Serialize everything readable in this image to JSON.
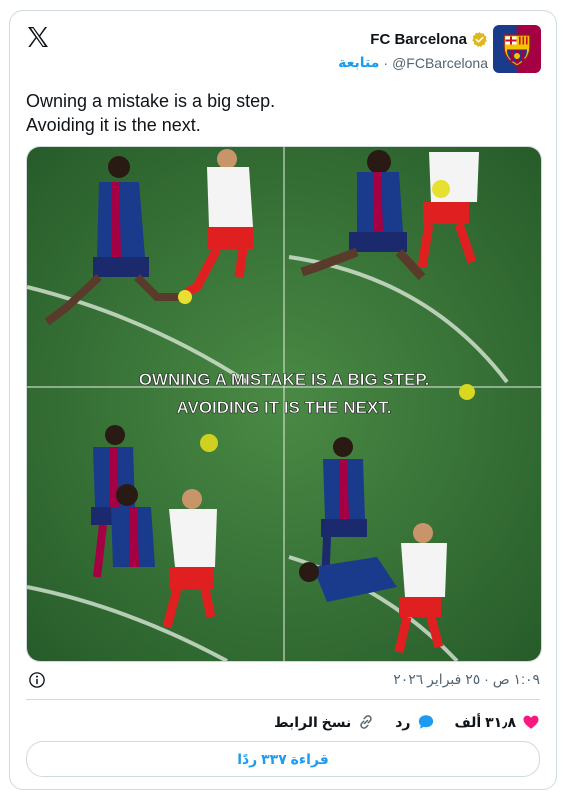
{
  "account": {
    "display_name": "FC Barcelona",
    "handle": "@FCBarcelona",
    "separator": "·",
    "follow_label": "متابعة"
  },
  "tweet": {
    "lines": [
      "Owning a mistake is a big step.",
      "Avoiding it is the next."
    ],
    "media_caption_lines": [
      "OWNING A MISTAKE IS A BIG STEP.",
      "AVOIDING IT IS THE NEXT."
    ],
    "timestamp": "١:٠٩ ص · ٢٥ فبراير ٢٠٢٦"
  },
  "actions": {
    "likes_count": "٣١٫٨ ألف",
    "reply_label": "رد",
    "copy_link_label": "نسخ الرابط"
  },
  "replies_button_label": "قراءة ٣٣٧ ردًا",
  "colors": {
    "accent": "#1d9bf0",
    "like": "#f91880",
    "verified_gold": "#e2b719",
    "pitch": "#3d7a3a"
  }
}
